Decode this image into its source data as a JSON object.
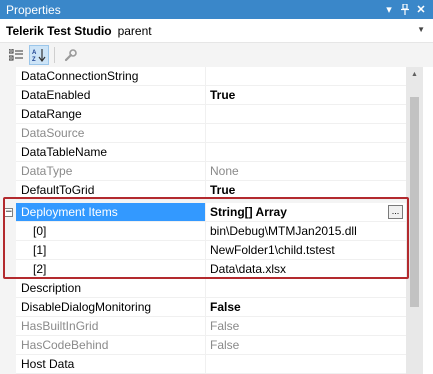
{
  "panel": {
    "title": "Properties"
  },
  "object_selector": {
    "name": "Telerik Test Studio",
    "type": "parent"
  },
  "toolbar": {
    "categorized_icon": "categorized-icon",
    "alphabetical_icon": "alphabetical-icon",
    "property_pages_icon": "wrench-icon"
  },
  "rows": [
    {
      "name": "DataConnectionString",
      "value": "",
      "readonly": false,
      "bold": false
    },
    {
      "name": "DataEnabled",
      "value": "True",
      "readonly": false,
      "bold": true
    },
    {
      "name": "DataRange",
      "value": "",
      "readonly": false,
      "bold": false
    },
    {
      "name": "DataSource",
      "value": "",
      "readonly": true,
      "bold": false
    },
    {
      "name": "DataTableName",
      "value": "",
      "readonly": false,
      "bold": false
    },
    {
      "name": "DataType",
      "value": "None",
      "readonly": true,
      "bold": false
    },
    {
      "name": "DefaultToGrid",
      "value": "True",
      "readonly": false,
      "bold": true
    },
    {
      "name": "Deployment Items",
      "value": "String[] Array",
      "readonly": false,
      "bold": true
    },
    {
      "name": "[0]",
      "value": "bin\\Debug\\MTMJan2015.dll",
      "readonly": false,
      "bold": false
    },
    {
      "name": "[1]",
      "value": "NewFolder1\\child.tstest",
      "readonly": false,
      "bold": false
    },
    {
      "name": "[2]",
      "value": "Data\\data.xlsx",
      "readonly": false,
      "bold": false
    },
    {
      "name": "Description",
      "value": "",
      "readonly": false,
      "bold": false
    },
    {
      "name": "DisableDialogMonitoring",
      "value": "False",
      "readonly": false,
      "bold": true
    },
    {
      "name": "HasBuiltInGrid",
      "value": "False",
      "readonly": true,
      "bold": false
    },
    {
      "name": "HasCodeBehind",
      "value": "False",
      "readonly": true,
      "bold": false
    },
    {
      "name": "Host Data",
      "value": "",
      "readonly": false,
      "bold": false
    }
  ],
  "ellipsis_label": "...",
  "expander_symbol": "−",
  "colors": {
    "titlebar": "#3a87c9",
    "selection": "#3399ff",
    "highlight_border": "#b32a2e"
  }
}
